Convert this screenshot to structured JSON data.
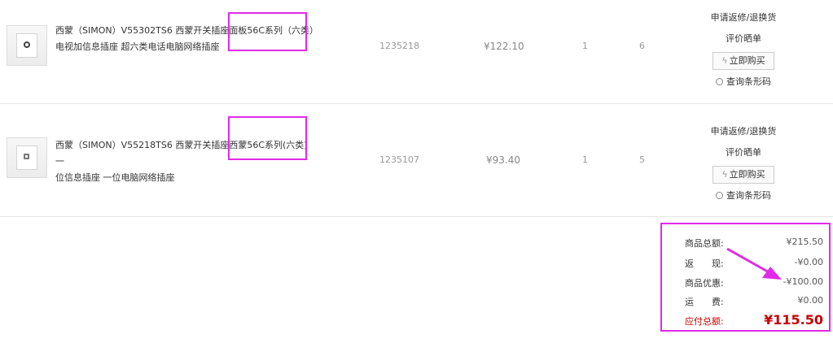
{
  "items": [
    {
      "name_line1": "西蒙（SIMON）V55302TS6 西蒙开关插座面板56C系列（六类）",
      "name_line2": "电视加信息插座 超六类电话电脑网络插座",
      "sku": "1235218",
      "price": "¥122.10",
      "qty": "1",
      "extra": "6",
      "ops": {
        "return_label": "申请返修/退换货",
        "review_label": "评价晒单",
        "buy_label": "立即购买",
        "barcode_label": "查询条形码"
      }
    },
    {
      "name_line1": "西蒙（SIMON）V55218TS6 西蒙开关插座西蒙56C系列(六类) 一",
      "name_line2": "位信息插座 一位电脑网络插座",
      "sku": "1235107",
      "price": "¥93.40",
      "qty": "1",
      "extra": "5",
      "ops": {
        "return_label": "申请返修/退换货",
        "review_label": "评价晒单",
        "buy_label": "立即购买",
        "barcode_label": "查询条形码"
      }
    }
  ],
  "summary": {
    "goods_total_label": "商品总额:",
    "goods_total_value": "¥215.50",
    "cashback_label": "返　　现:",
    "cashback_value": "-¥0.00",
    "discount_label": "商品优惠:",
    "discount_value": "-¥100.00",
    "shipping_label": "运　　费:",
    "shipping_value": "¥0.00",
    "payable_label": "应付总额:",
    "payable_value": "¥115.50"
  },
  "colors": {
    "highlight": "#e02be8",
    "price_red": "#c40000"
  }
}
